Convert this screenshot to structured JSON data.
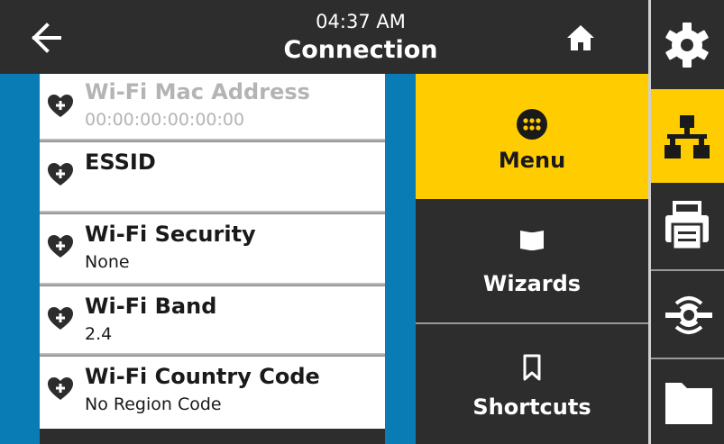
{
  "header": {
    "time": "04:37 AM",
    "title": "Connection",
    "back_icon": "arrow-left-icon",
    "home_icon": "home-icon"
  },
  "list": {
    "items": [
      {
        "title": "Wi-Fi Mac Address",
        "value": "00:00:00:00:00:00",
        "state": "disabled",
        "icon": "heart-plus-icon"
      },
      {
        "title": "ESSID",
        "value": "",
        "state": "enabled",
        "icon": "heart-plus-icon"
      },
      {
        "title": "Wi-Fi Security",
        "value": "None",
        "state": "enabled",
        "icon": "heart-plus-icon"
      },
      {
        "title": "Wi-Fi Band",
        "value": "2.4",
        "state": "enabled",
        "icon": "heart-plus-icon"
      },
      {
        "title": "Wi-Fi Country Code",
        "value": "No Region Code",
        "state": "enabled",
        "icon": "heart-plus-icon"
      }
    ]
  },
  "nav": {
    "buttons": [
      {
        "label": "Menu",
        "icon": "grid-dots-icon",
        "active": true
      },
      {
        "label": "Wizards",
        "icon": "book-icon",
        "active": false
      },
      {
        "label": "Shortcuts",
        "icon": "bookmark-icon",
        "active": false
      }
    ]
  },
  "rail": {
    "items": [
      {
        "icon": "gear-icon",
        "active": false
      },
      {
        "icon": "network-icon",
        "active": true
      },
      {
        "icon": "printer-icon",
        "active": false
      },
      {
        "icon": "rfid-icon",
        "active": false
      },
      {
        "icon": "folder-icon",
        "active": false
      }
    ]
  },
  "colors": {
    "accent": "#ffcc00",
    "list_bg": "#0a7cb5",
    "dark": "#2d2d2d",
    "disabled_text": "#b4b4b4"
  }
}
